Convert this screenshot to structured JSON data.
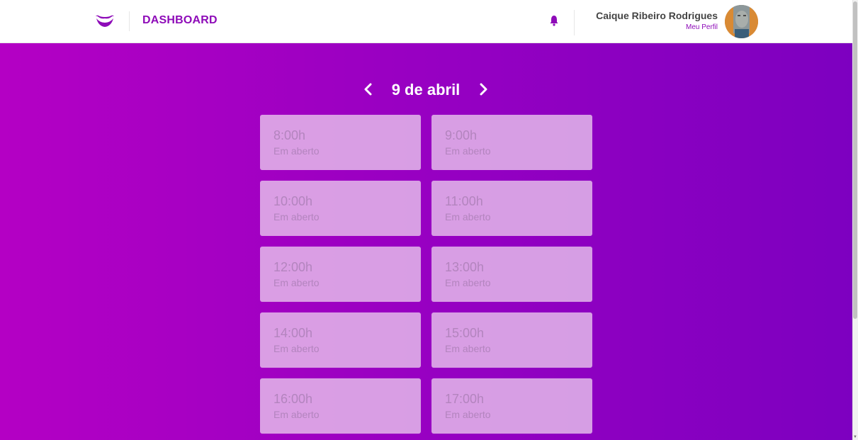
{
  "header": {
    "title": "DASHBOARD",
    "logo_icon": "mustache-icon",
    "notification_icon": "bell-icon",
    "user": {
      "name": "Caique Ribeiro Rodrigues",
      "profile_link": "Meu Perfil"
    }
  },
  "schedule": {
    "date_label": "9 de abril",
    "prev_icon": "chevron-left-icon",
    "next_icon": "chevron-right-icon",
    "slots": [
      {
        "time": "8:00h",
        "status": "Em aberto"
      },
      {
        "time": "9:00h",
        "status": "Em aberto"
      },
      {
        "time": "10:00h",
        "status": "Em aberto"
      },
      {
        "time": "11:00h",
        "status": "Em aberto"
      },
      {
        "time": "12:00h",
        "status": "Em aberto"
      },
      {
        "time": "13:00h",
        "status": "Em aberto"
      },
      {
        "time": "14:00h",
        "status": "Em aberto"
      },
      {
        "time": "15:00h",
        "status": "Em aberto"
      },
      {
        "time": "16:00h",
        "status": "Em aberto"
      },
      {
        "time": "17:00h",
        "status": "Em aberto"
      }
    ]
  },
  "colors": {
    "brand": "#8e0bb8",
    "gradient_start": "#b400c4",
    "gradient_end": "#7d00c0",
    "slot_text": "#b384be"
  }
}
